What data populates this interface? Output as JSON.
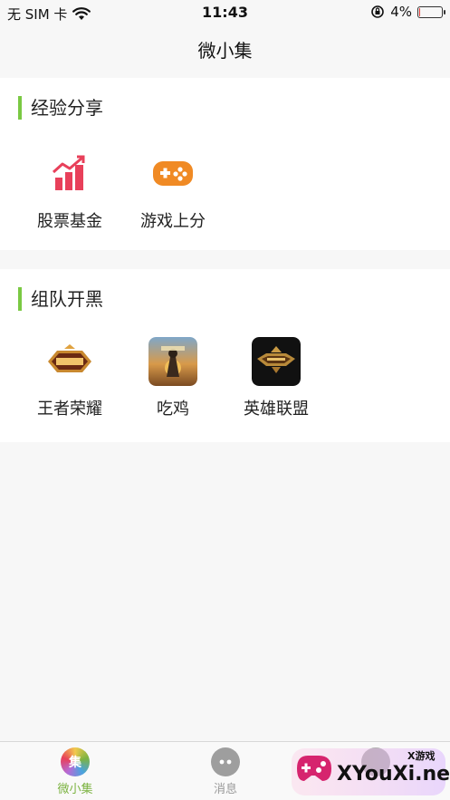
{
  "status_bar": {
    "carrier": "无 SIM 卡",
    "time": "11:43",
    "battery": "4%",
    "battery_level": 0.04
  },
  "nav": {
    "title": "微小集"
  },
  "sections": [
    {
      "title": "经验分享",
      "items": [
        {
          "label": "股票基金",
          "icon": "stock-chart-icon"
        },
        {
          "label": "游戏上分",
          "icon": "gamepad-icon"
        }
      ]
    },
    {
      "title": "组队开黑",
      "items": [
        {
          "label": "王者荣耀",
          "icon": "honor-of-kings-logo"
        },
        {
          "label": "吃鸡",
          "icon": "pubg-game-icon"
        },
        {
          "label": "英雄联盟",
          "icon": "league-of-legends-icon"
        }
      ]
    }
  ],
  "tabs": [
    {
      "label": "微小集",
      "badge": "集",
      "active": true
    },
    {
      "label": "消息",
      "active": false
    }
  ],
  "watermark": {
    "brand": "XYouXi.net",
    "tag": "X游戏"
  },
  "colors": {
    "accent_green": "#7ac943",
    "stock_red": "#e8405a",
    "game_orange": "#f08a24",
    "tab_active": "#7cb342",
    "tab_inactive": "#999999"
  }
}
